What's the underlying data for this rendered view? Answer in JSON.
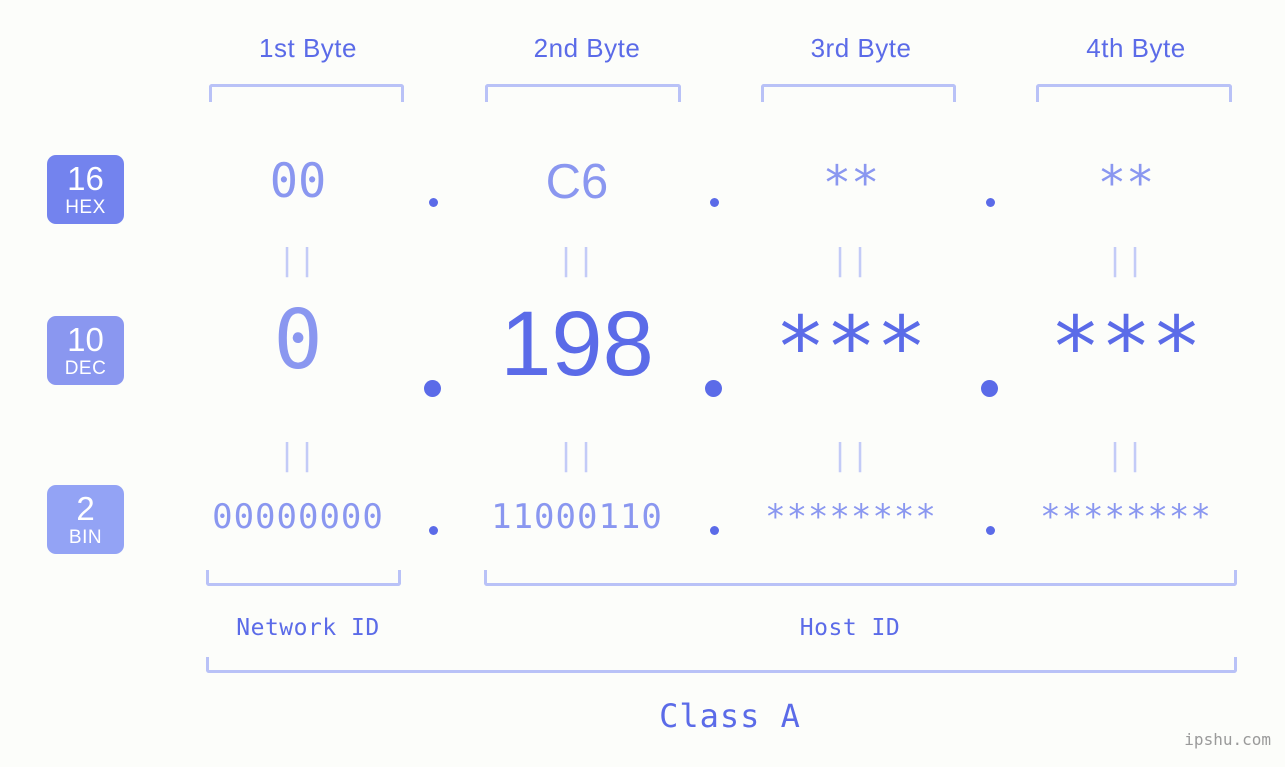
{
  "background_color": "#fcfdfa",
  "accent_color": "#5b6be8",
  "muted_color": "#8a97f0",
  "bracket_color": "#b9c2f7",
  "header": {
    "byte_labels": [
      "1st Byte",
      "2nd Byte",
      "3rd Byte",
      "4th Byte"
    ]
  },
  "radix_rows": [
    {
      "base": "16",
      "system": "HEX",
      "badge_color": "#7383ee",
      "values": [
        "00",
        "C6",
        "**",
        "**"
      ],
      "separator": "."
    },
    {
      "base": "10",
      "system": "DEC",
      "badge_color": "#8a97f0",
      "values": [
        "0",
        "198",
        "***",
        "***"
      ],
      "separator": "."
    },
    {
      "base": "2",
      "system": "BIN",
      "badge_color": "#93a3f5",
      "values": [
        "00000000",
        "11000110",
        "********",
        "********"
      ],
      "separator": "."
    }
  ],
  "equality_marks": [
    "||",
    "||",
    "||",
    "||"
  ],
  "footer": {
    "network_id_label": "Network ID",
    "host_id_label": "Host ID",
    "class_label": "Class A"
  },
  "watermark": "ipshu.com"
}
